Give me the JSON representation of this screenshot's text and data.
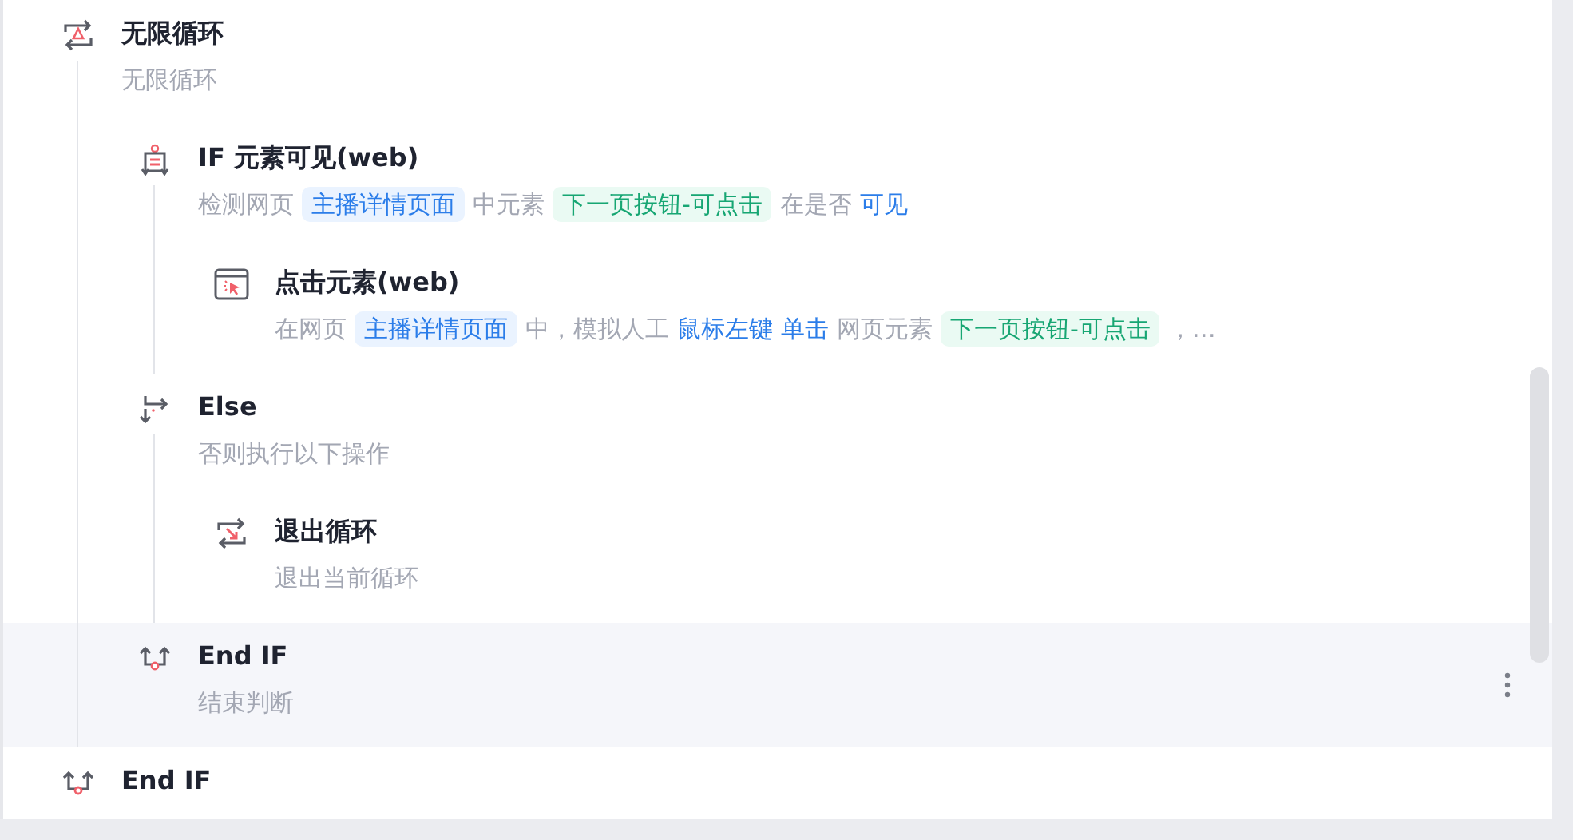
{
  "steps": [
    {
      "kind": "loop",
      "title": "无限循环",
      "selected": false,
      "description": [
        {
          "kind": "text",
          "text": "无限循环"
        }
      ],
      "children": [
        {
          "kind": "if",
          "title": "IF 元素可见(web)",
          "selected": false,
          "description": [
            {
              "kind": "text",
              "text": "检测网页"
            },
            {
              "kind": "page",
              "text": "主播详情页面"
            },
            {
              "kind": "text",
              "text": "中元素"
            },
            {
              "kind": "element",
              "text": "下一页按钮-可点击"
            },
            {
              "kind": "text",
              "text": "在是否"
            },
            {
              "kind": "link",
              "text": "可见"
            }
          ],
          "children": [
            {
              "kind": "click",
              "title": "点击元素(web)",
              "selected": false,
              "description": [
                {
                  "kind": "text",
                  "text": "在网页"
                },
                {
                  "kind": "page",
                  "text": "主播详情页面"
                },
                {
                  "kind": "text",
                  "text": "中，模拟人工"
                },
                {
                  "kind": "link",
                  "text": "鼠标左键"
                },
                {
                  "kind": "link",
                  "text": "单击"
                },
                {
                  "kind": "text",
                  "text": "网页元素"
                },
                {
                  "kind": "element",
                  "text": "下一页按钮-可点击"
                },
                {
                  "kind": "text",
                  "text": "，…"
                }
              ]
            }
          ]
        },
        {
          "kind": "else",
          "title": "Else",
          "selected": false,
          "description": [
            {
              "kind": "text",
              "text": "否则执行以下操作"
            }
          ],
          "children": [
            {
              "kind": "break",
              "title": "退出循环",
              "selected": false,
              "description": [
                {
                  "kind": "text",
                  "text": "退出当前循环"
                }
              ]
            }
          ]
        },
        {
          "kind": "endif",
          "title": "End IF",
          "selected": true,
          "description": [
            {
              "kind": "text",
              "text": "结束判断"
            }
          ]
        }
      ]
    },
    {
      "kind": "endif",
      "title": "End IF",
      "selected": false
    }
  ]
}
